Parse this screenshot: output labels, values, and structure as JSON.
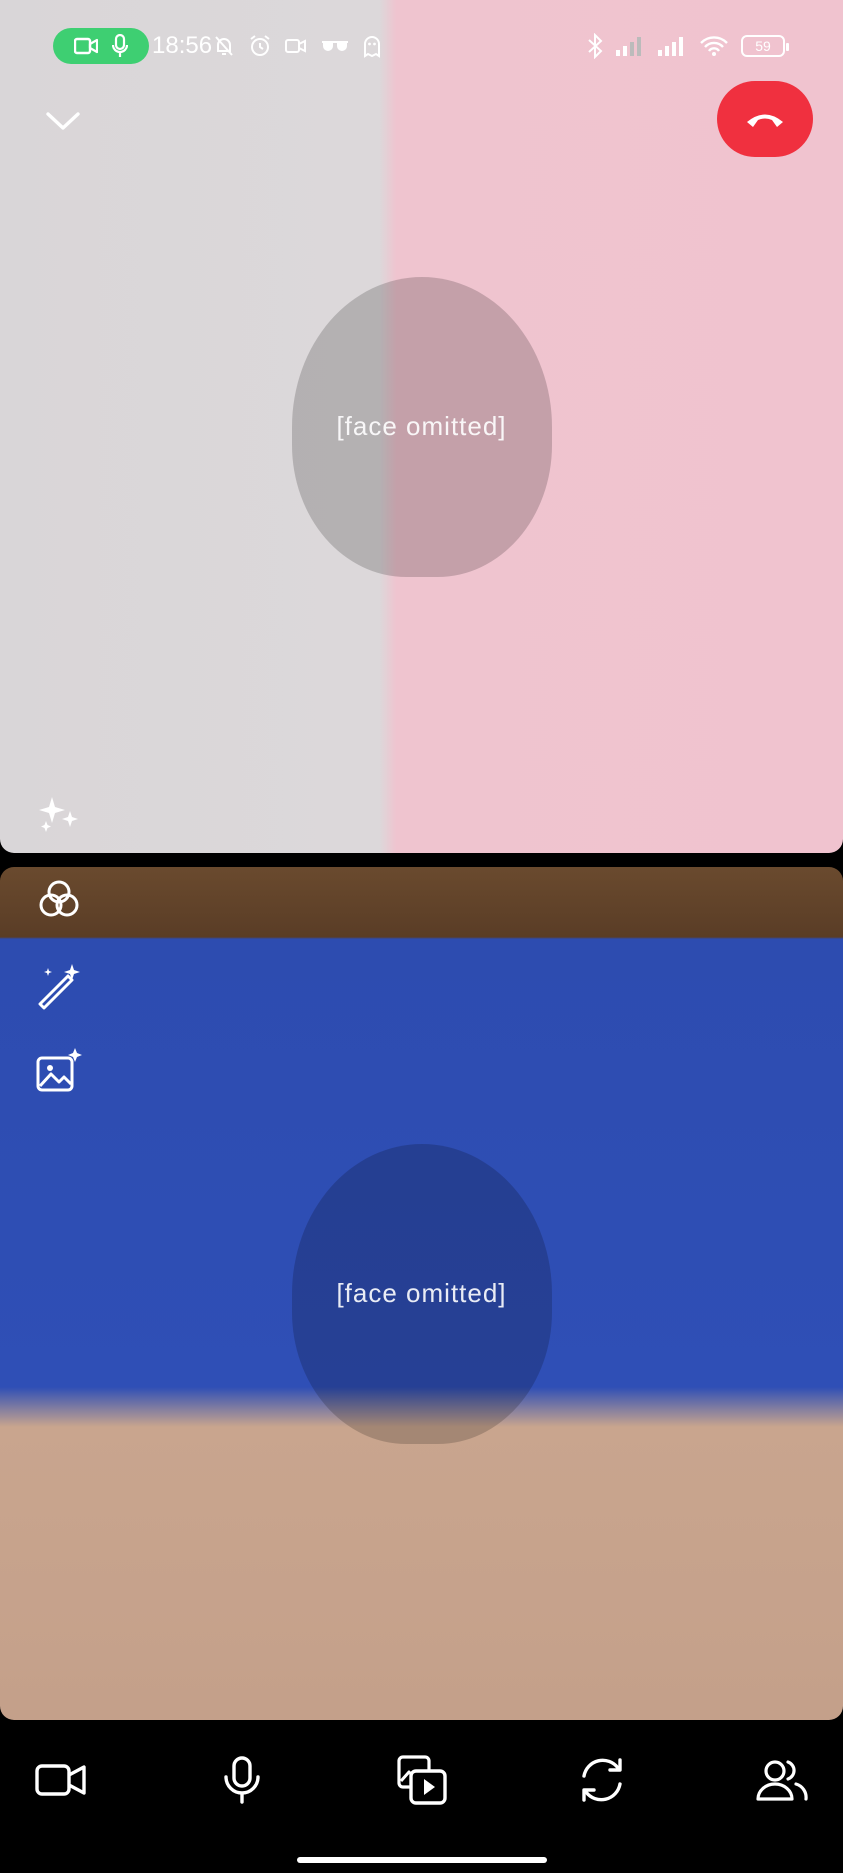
{
  "status_bar": {
    "time": "18:56",
    "battery": "59",
    "pill_color": "#3ecf72",
    "left_icons": [
      "video-icon",
      "mic-icon",
      "bell-off-icon",
      "alarm-icon",
      "video-outline-icon",
      "glasses-icon",
      "ghost-icon"
    ],
    "right_icons": [
      "bluetooth-icon",
      "signal-icon",
      "signal-icon",
      "wifi-icon",
      "battery-icon"
    ]
  },
  "remote_feed": {
    "placeholder": "[face omitted]"
  },
  "self_feed": {
    "placeholder": "[face omitted]"
  },
  "controls": {
    "end_call_color": "#f0303f",
    "top_icons": [
      "chevron-down-icon",
      "end-call-icon"
    ],
    "remote_icons": [
      "sparkles-icon"
    ],
    "self_icons": [
      "filters-icon",
      "magic-wand-icon",
      "image-sparkle-icon"
    ],
    "bottom_icons": [
      "camera-icon",
      "microphone-icon",
      "media-share-icon",
      "flip-camera-icon",
      "participants-icon"
    ]
  }
}
